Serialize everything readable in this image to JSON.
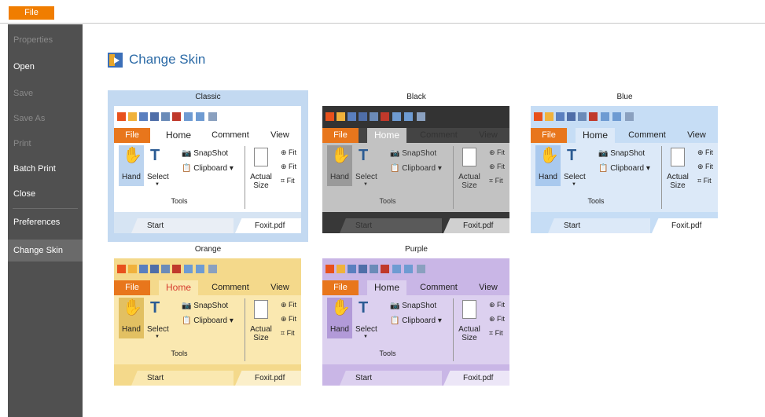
{
  "file_tab": {
    "label": "File"
  },
  "sidebar": {
    "items": [
      {
        "label": "Properties",
        "state": "disabled"
      },
      {
        "label": "Open",
        "state": "normal"
      },
      {
        "label": "Save",
        "state": "disabled"
      },
      {
        "label": "Save As",
        "state": "disabled"
      },
      {
        "label": "Print",
        "state": "disabled"
      },
      {
        "label": "Batch Print",
        "state": "normal"
      },
      {
        "label": "Close",
        "state": "normal"
      },
      {
        "label": "Preferences",
        "state": "normal"
      },
      {
        "label": "Change Skin",
        "state": "active"
      }
    ]
  },
  "page": {
    "title": "Change Skin",
    "icon": "change-skin-icon"
  },
  "preview_labels": {
    "file": "File",
    "home": "Home",
    "comment": "Comment",
    "view": "View",
    "hand": "Hand",
    "select": "Select",
    "snapshot": "SnapShot",
    "clipboard": "Clipboard",
    "actual": "Actual",
    "size": "Size",
    "fit": "Fit",
    "tools": "Tools",
    "start": "Start",
    "doc": "Foxit.pdf"
  },
  "skins": [
    {
      "name": "Classic",
      "selected": true,
      "colors": {
        "qa": "#ffffff",
        "tabs": "#ffffff",
        "rib": "#ffffff",
        "hand": "#bcd4ef",
        "bottom": "#d6e4f3",
        "st": "#e9eef5",
        "fx": "#ffffff",
        "text": "#222222",
        "home": "#222222"
      }
    },
    {
      "name": "Black",
      "selected": false,
      "colors": {
        "qa": "#333333",
        "tabs": "#444444",
        "rib": "#c2c2c2",
        "hand": "#9a9a9a",
        "bottom": "#383838",
        "st": "#5a5a5a",
        "fx": "#d0d0d0",
        "text": "#333333",
        "home": "#ffffff"
      }
    },
    {
      "name": "Blue",
      "selected": false,
      "colors": {
        "qa": "#c6ddf5",
        "tabs": "#c6ddf5",
        "rib": "#dce9f8",
        "hand": "#a9c9ee",
        "bottom": "#c6ddf5",
        "st": "#dce9f8",
        "fx": "#ffffff",
        "text": "#222222",
        "home": "#222222"
      }
    },
    {
      "name": "Orange",
      "selected": false,
      "colors": {
        "qa": "#f4d98b",
        "tabs": "#f4d98b",
        "rib": "#fae8b0",
        "hand": "#e2c062",
        "bottom": "#f4d98b",
        "st": "#fae8b0",
        "fx": "#fbefca",
        "text": "#222222",
        "home": "#d63b2f"
      }
    },
    {
      "name": "Purple",
      "selected": false,
      "colors": {
        "qa": "#c9b6e6",
        "tabs": "#c9b6e6",
        "rib": "#dcd0ef",
        "hand": "#b29ad8",
        "bottom": "#c9b6e6",
        "st": "#dcd0ef",
        "fx": "#ece6f7",
        "text": "#222222",
        "home": "#222222"
      }
    }
  ]
}
